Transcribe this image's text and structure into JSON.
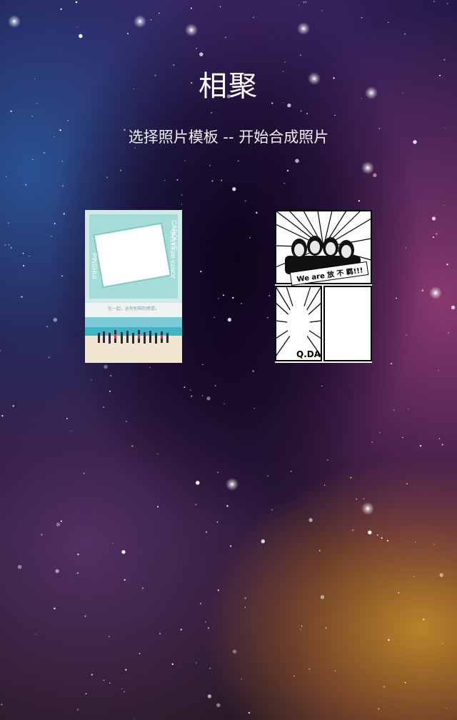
{
  "header": {
    "title": "相聚",
    "subtitle": "选择照片模板 -- 开始合成照片"
  },
  "templates": [
    {
      "id": "beach",
      "vertical_text_left": "PINSHUI",
      "vertical_text_right": "CAROLYE",
      "side_text_bottom": "JONYA WEEKEND",
      "caption": "在一起，总有别样的感觉。",
      "accent": "#a6dcd8"
    },
    {
      "id": "comic",
      "speech": "We are 放 不 羁!!!",
      "label": "Q.DA",
      "accent": "#000000"
    }
  ]
}
